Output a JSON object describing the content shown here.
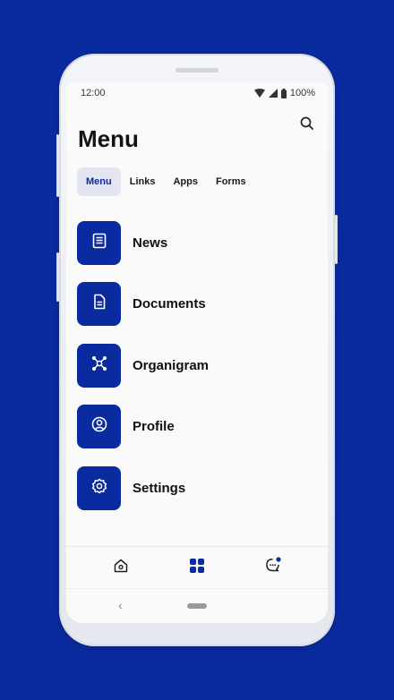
{
  "status": {
    "time": "12:00",
    "battery": "100%"
  },
  "header": {
    "title": "Menu"
  },
  "tabs": [
    {
      "label": "Menu",
      "active": true
    },
    {
      "label": "Links",
      "active": false
    },
    {
      "label": "Apps",
      "active": false
    },
    {
      "label": "Forms",
      "active": false
    }
  ],
  "menu": [
    {
      "label": "News",
      "icon": "news-icon"
    },
    {
      "label": "Documents",
      "icon": "document-icon"
    },
    {
      "label": "Organigram",
      "icon": "organigram-icon"
    },
    {
      "label": "Profile",
      "icon": "profile-icon"
    },
    {
      "label": "Settings",
      "icon": "gear-icon"
    }
  ],
  "bottom_nav": [
    {
      "icon": "home-icon"
    },
    {
      "icon": "grid-icon",
      "active": true
    },
    {
      "icon": "chat-icon",
      "badge": true
    }
  ],
  "colors": {
    "brand": "#0a2aa0",
    "background": "#0a2aa0",
    "active_tab_bg": "#e3e6f2"
  }
}
